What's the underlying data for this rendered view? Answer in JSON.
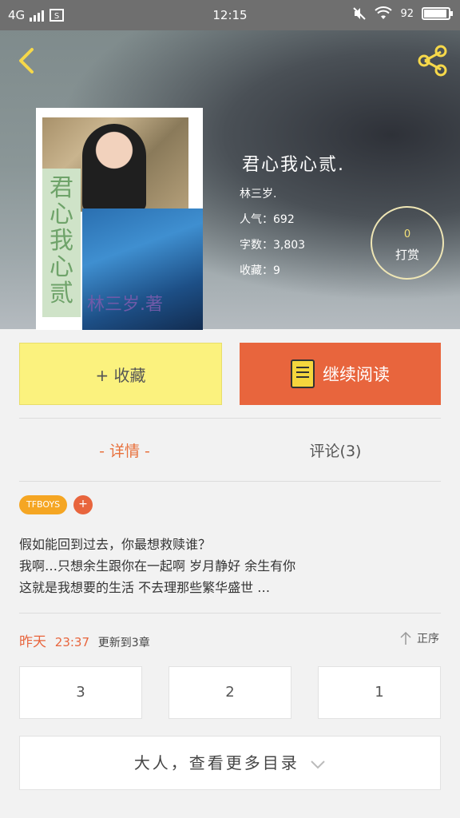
{
  "status_bar": {
    "network": "4G",
    "time": "12:15",
    "battery": "92",
    "battery_level": 0.92
  },
  "book": {
    "title": "君心我心贰.",
    "author": "林三岁.",
    "popularity": "人气：692",
    "word_count": "字数：3,803",
    "favorites": "收藏：9",
    "cover_title": "君心我心贰",
    "cover_author": "林三岁.著"
  },
  "tip": {
    "count": "0",
    "label": "打赏"
  },
  "actions": {
    "favorite_label": "+ 收藏",
    "read_label": "继续阅读"
  },
  "tabs": {
    "detail": "- 详情 -",
    "comment": "评论(3)"
  },
  "tags": {
    "items": [
      "TFBOYS"
    ],
    "add": "+"
  },
  "description": {
    "line1": "假如能回到过去，你最想救赎谁？",
    "line2": "我啊…只想余生跟你在一起啊 岁月静好 余生有你",
    "line3": "这就是我想要的生活 不去理那些繁华盛世 …"
  },
  "update": {
    "day": "昨天",
    "time": "23:37",
    "text": "更新到3章",
    "order_label": "正序"
  },
  "chapters": [
    "3",
    "2",
    "1"
  ],
  "more_toc": "大人，查看更多目录",
  "colors": {
    "accent_orange": "#e8653d",
    "favorite_yellow": "#fbf27e",
    "tag_orange": "#f5a623"
  }
}
